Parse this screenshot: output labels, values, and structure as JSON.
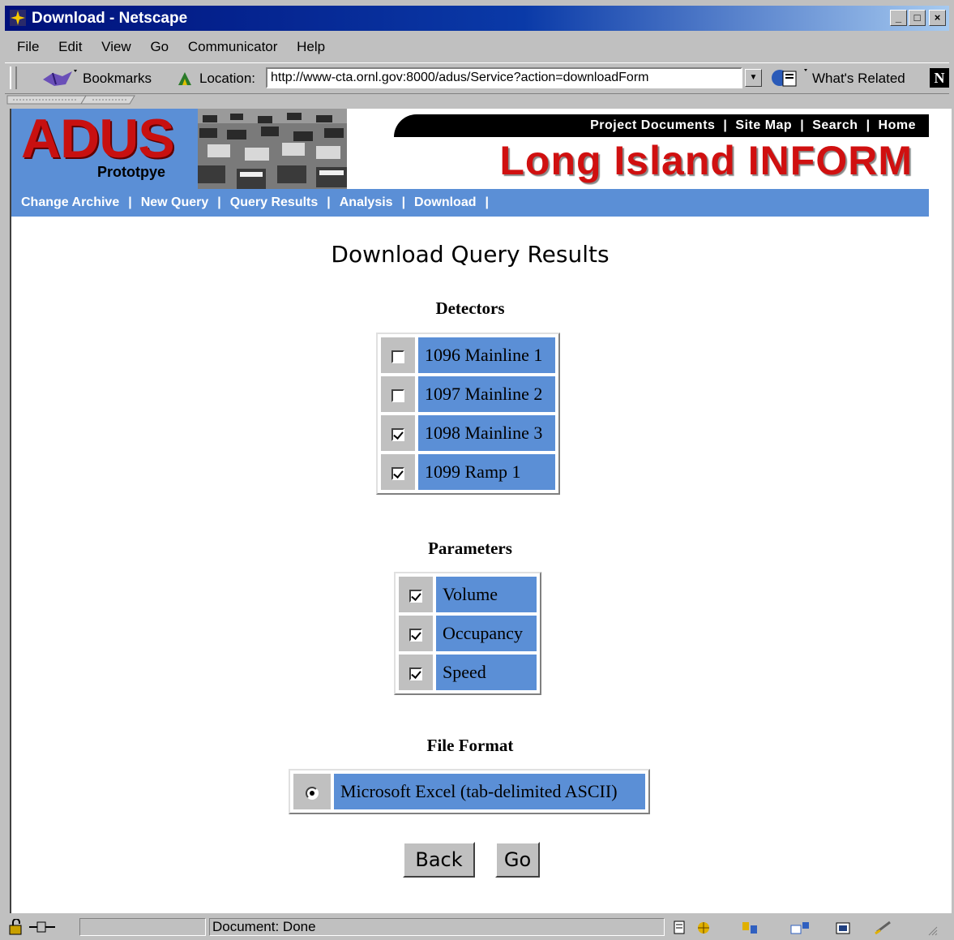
{
  "window": {
    "title": "Download - Netscape",
    "buttons": [
      "_",
      "□",
      "×"
    ]
  },
  "menu": [
    "File",
    "Edit",
    "View",
    "Go",
    "Communicator",
    "Help"
  ],
  "toolbar": {
    "bookmarks_label": "Bookmarks",
    "location_label": "Location:",
    "url": "http://www-cta.ornl.gov:8000/adus/Service?action=downloadForm",
    "whats_related_label": "What's Related"
  },
  "banner": {
    "logo_text": "ADUS",
    "logo_sub": "Prototpye",
    "brand": "Long Island INFORM",
    "top_nav": [
      "Project Documents",
      "Site Map",
      "Search",
      "Home"
    ],
    "sub_nav": [
      "Change Archive",
      "New Query",
      "Query Results",
      "Analysis",
      "Download"
    ]
  },
  "page": {
    "title": "Download Query Results",
    "detectors_heading": "Detectors",
    "detectors": [
      {
        "label": "1096 Mainline 1",
        "checked": false
      },
      {
        "label": "1097 Mainline 2",
        "checked": false
      },
      {
        "label": "1098 Mainline 3",
        "checked": true
      },
      {
        "label": "1099 Ramp 1",
        "checked": true
      }
    ],
    "parameters_heading": "Parameters",
    "parameters": [
      {
        "label": "Volume",
        "checked": true
      },
      {
        "label": "Occupancy",
        "checked": true
      },
      {
        "label": "Speed",
        "checked": true
      }
    ],
    "format_heading": "File Format",
    "format_option": {
      "label": "Microsoft Excel (tab-delimited ASCII)",
      "selected": true
    },
    "back_label": "Back",
    "go_label": "Go"
  },
  "status": {
    "text": "Document: Done"
  },
  "colors": {
    "cell_blue": "#5b8fd6",
    "brand_red": "#d01010",
    "title_blue": "#00107a"
  }
}
